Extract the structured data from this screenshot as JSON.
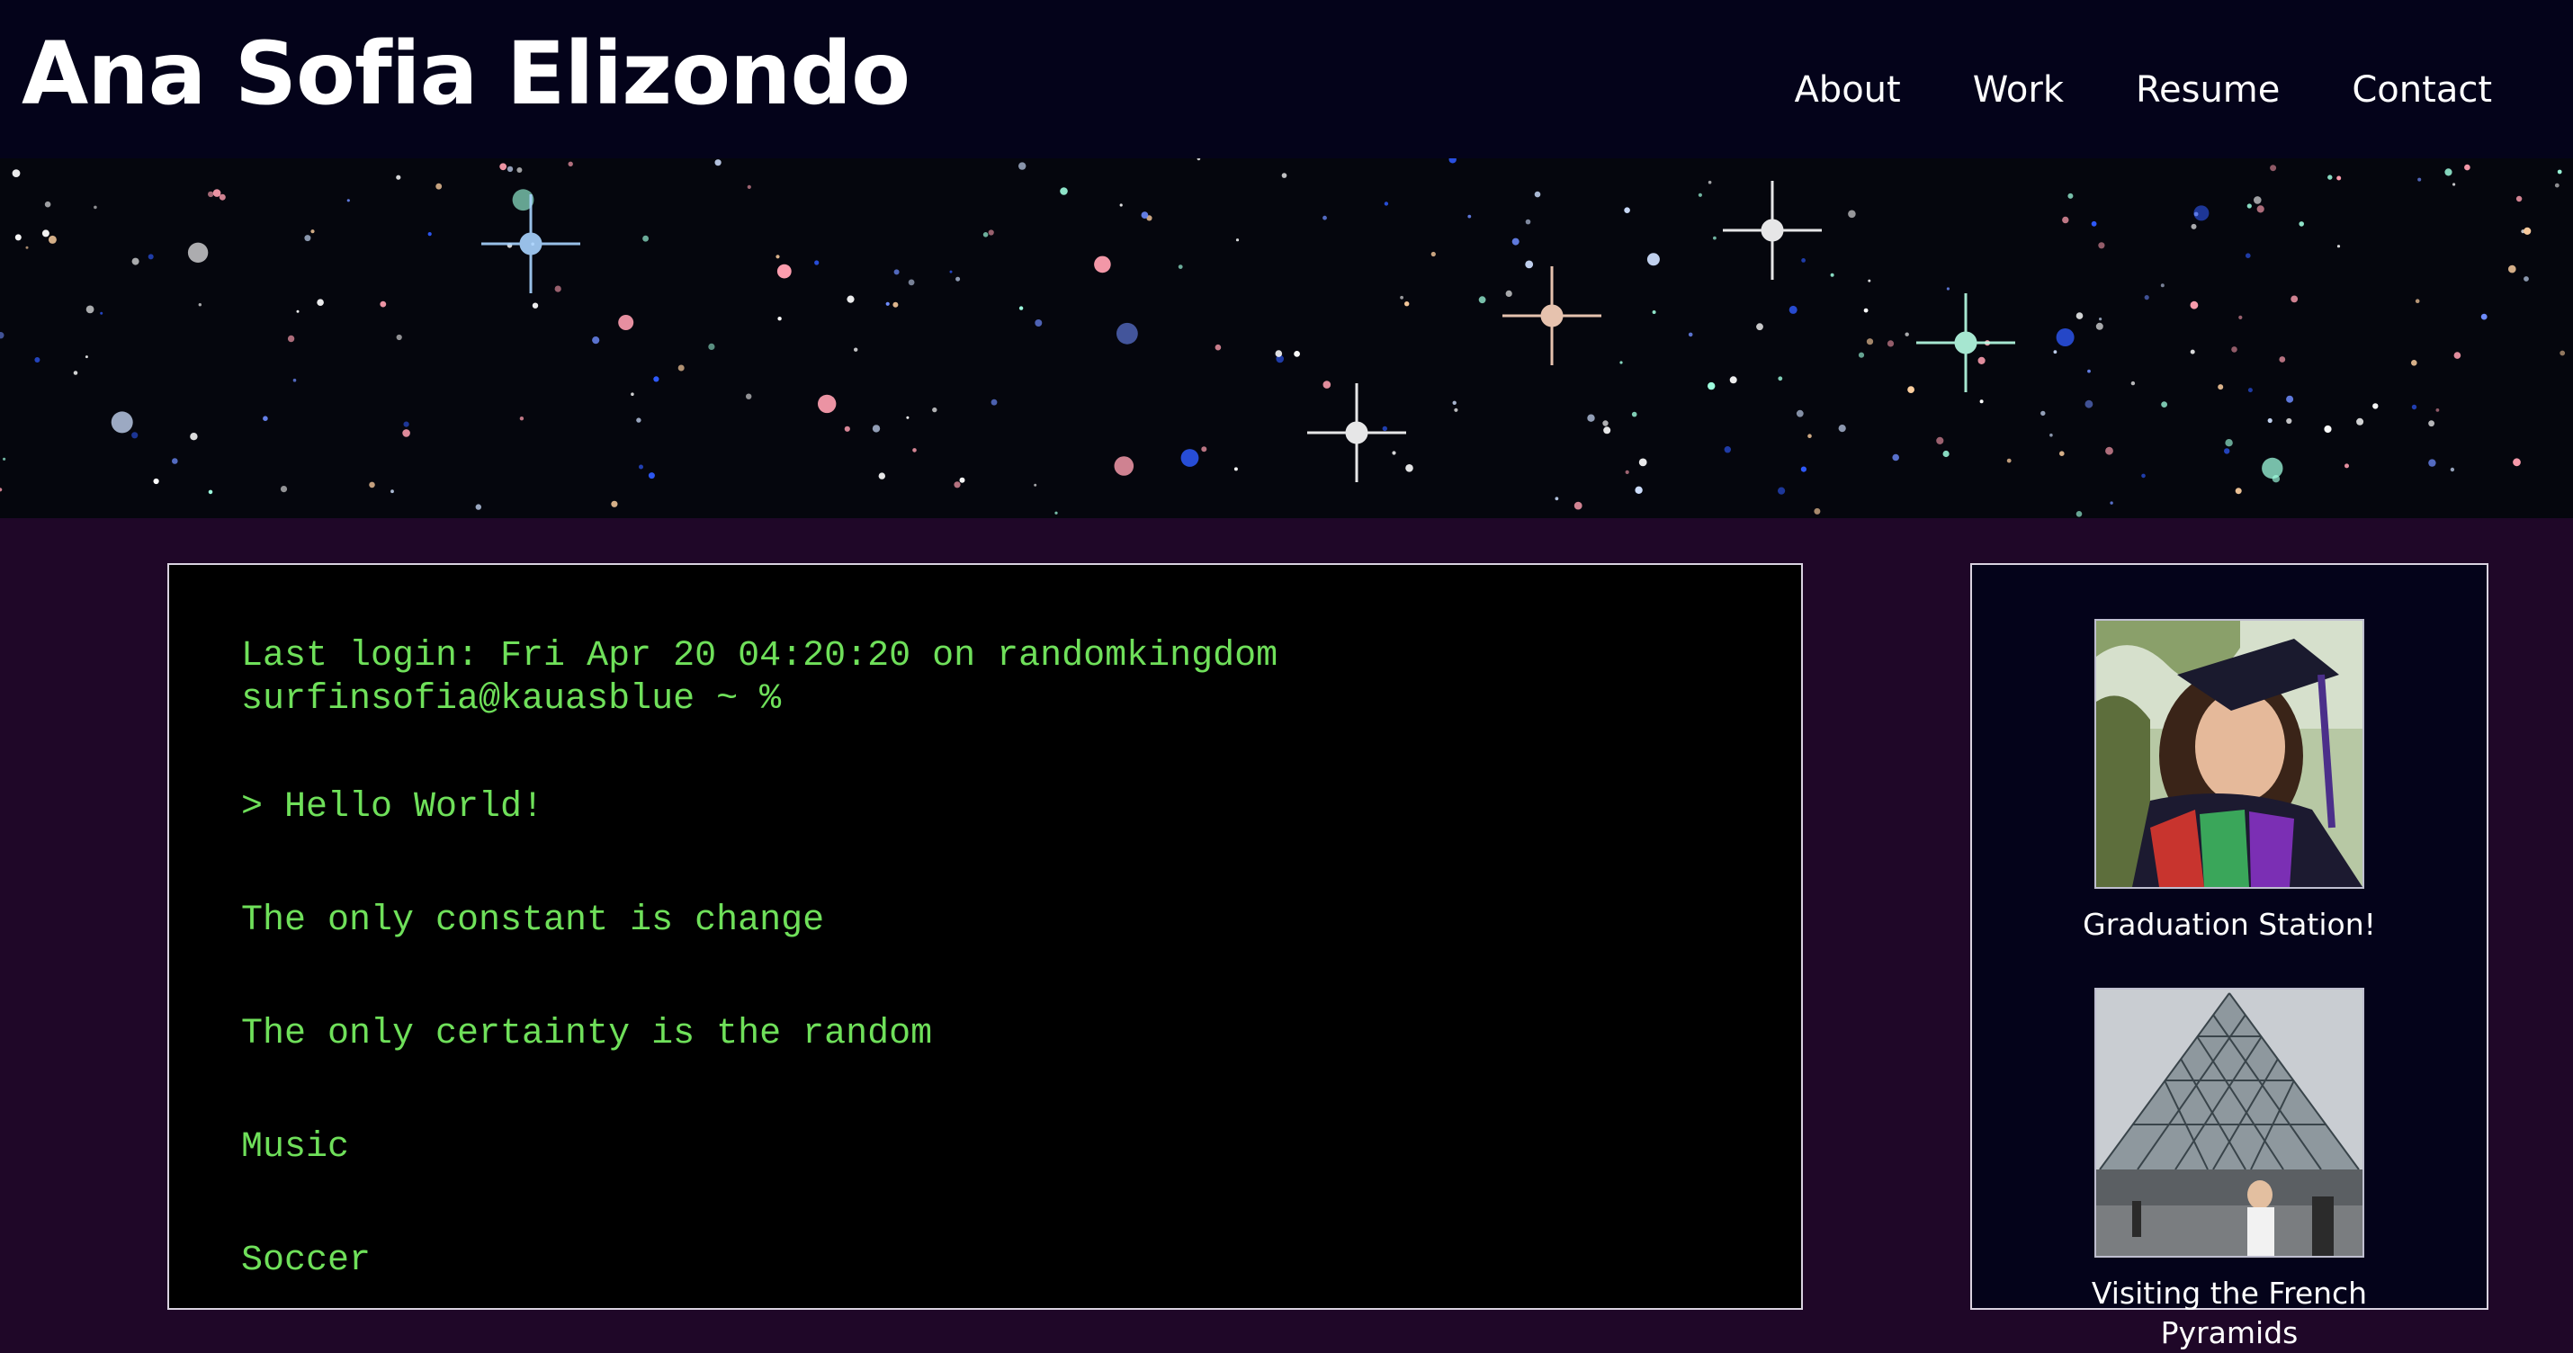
{
  "header": {
    "site_title": "Ana Sofia Elizondo",
    "nav": [
      {
        "label": "About"
      },
      {
        "label": "Work"
      },
      {
        "label": "Resume"
      },
      {
        "label": "Contact"
      }
    ]
  },
  "terminal": {
    "lines": [
      "Last login: Fri Apr 20 04:20:20 on randomkingdom",
      "surfinsofia@kauasblue ~ %",
      "> Hello World!",
      "The only constant is change",
      "The only certainty is the random",
      "Music",
      "Soccer"
    ]
  },
  "sidebar": {
    "photos": [
      {
        "caption": "Graduation Station!",
        "icon": "graduation-photo"
      },
      {
        "caption": "Visiting the French Pyramids",
        "icon": "pyramid-photo"
      }
    ]
  },
  "colors": {
    "header_bg": "#04031a",
    "page_bg": "#1f0728",
    "terminal_text": "#6fe05a",
    "terminal_bg": "#000000"
  }
}
